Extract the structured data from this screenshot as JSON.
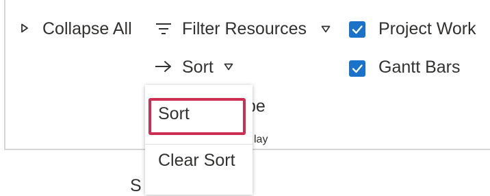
{
  "ribbon": {
    "collapse_all": {
      "label": "Collapse All",
      "icon": "caret-right-icon"
    },
    "filter_resources": {
      "label": "Filter Resources",
      "icon": "filter-lines-icon",
      "dropdown_icon": "caret-down-icon"
    },
    "sort": {
      "label": "Sort",
      "icon": "arrow-right-icon",
      "dropdown_icon": "caret-down-icon"
    },
    "project_work": {
      "label": "Project Work",
      "checked": true
    },
    "gantt_bars": {
      "label": "Gantt Bars",
      "checked": true
    },
    "partial_group_label_a": "pe",
    "partial_group_label_b": "lay",
    "checkbox_color": "#1a73c8"
  },
  "sort_menu": {
    "items": [
      {
        "label": "Sort",
        "highlighted": true
      },
      {
        "label": "Clear Sort",
        "highlighted": false
      }
    ],
    "highlight_color": "#cc2f52"
  },
  "below_ribbon_fragment": "S"
}
